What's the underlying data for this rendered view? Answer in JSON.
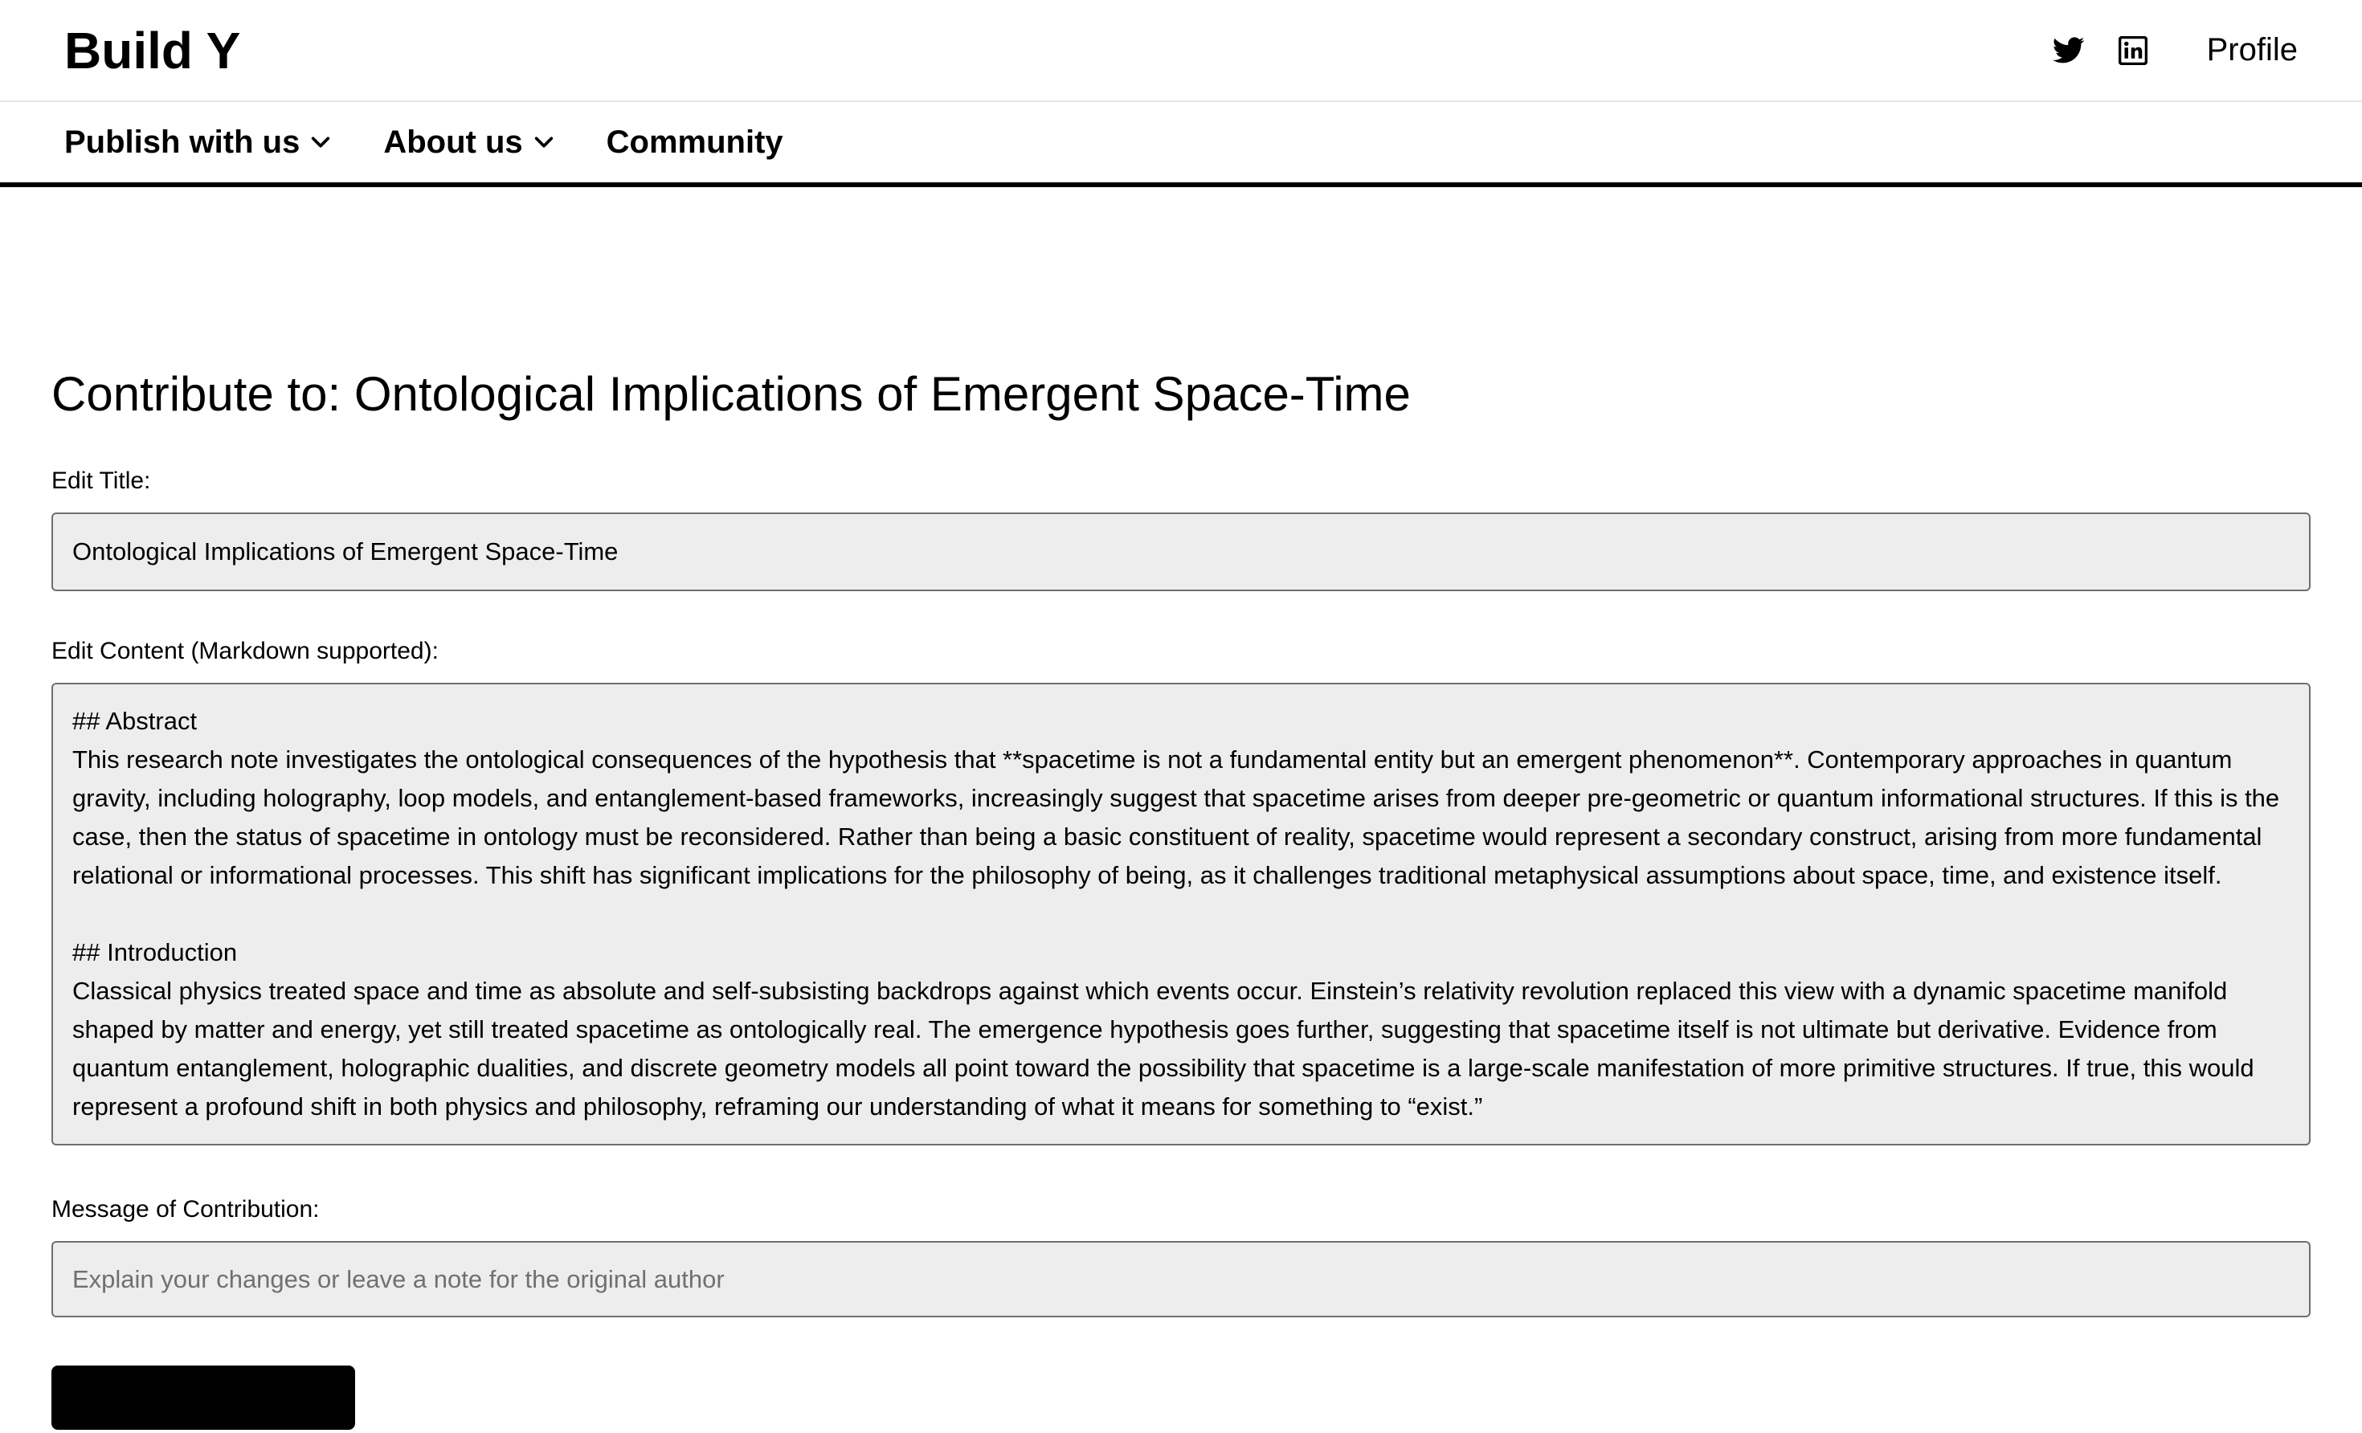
{
  "header": {
    "logo": "Build Y",
    "profile_label": "Profile",
    "icons": [
      "twitter-icon",
      "linkedin-icon"
    ]
  },
  "nav": {
    "items": [
      {
        "label": "Publish with us",
        "has_dropdown": true
      },
      {
        "label": "About us",
        "has_dropdown": true
      },
      {
        "label": "Community",
        "has_dropdown": false
      }
    ]
  },
  "form": {
    "page_title": "Contribute to: Ontological Implications of Emergent Space-Time",
    "title_label": "Edit Title:",
    "title_value": "Ontological Implications of Emergent Space-Time",
    "content_label": "Edit Content (Markdown supported):",
    "content_value": "## Abstract\nThis research note investigates the ontological consequences of the hypothesis that **spacetime is not a fundamental entity but an emergent phenomenon**. Contemporary approaches in quantum gravity, including holography, loop models, and entanglement-based frameworks, increasingly suggest that spacetime arises from deeper pre-geometric or quantum informational structures. If this is the case, then the status of spacetime in ontology must be reconsidered. Rather than being a basic constituent of reality, spacetime would represent a secondary construct, arising from more fundamental relational or informational processes. This shift has significant implications for the philosophy of being, as it challenges traditional metaphysical assumptions about space, time, and existence itself.\n\n## Introduction\nClassical physics treated space and time as absolute and self-subsisting backdrops against which events occur. Einstein’s relativity revolution replaced this view with a dynamic spacetime manifold shaped by matter and energy, yet still treated spacetime as ontologically real. The emergence hypothesis goes further, suggesting that spacetime itself is not ultimate but derivative. Evidence from quantum entanglement, holographic dualities, and discrete geometry models all point toward the possibility that spacetime is a large-scale manifestation of more primitive structures. If true, this would represent a profound shift in both physics and philosophy, reframing our understanding of what it means for something to “exist.”",
    "message_label": "Message of Contribution:",
    "message_value": "",
    "message_placeholder": "Explain your changes or leave a note for the original author"
  }
}
